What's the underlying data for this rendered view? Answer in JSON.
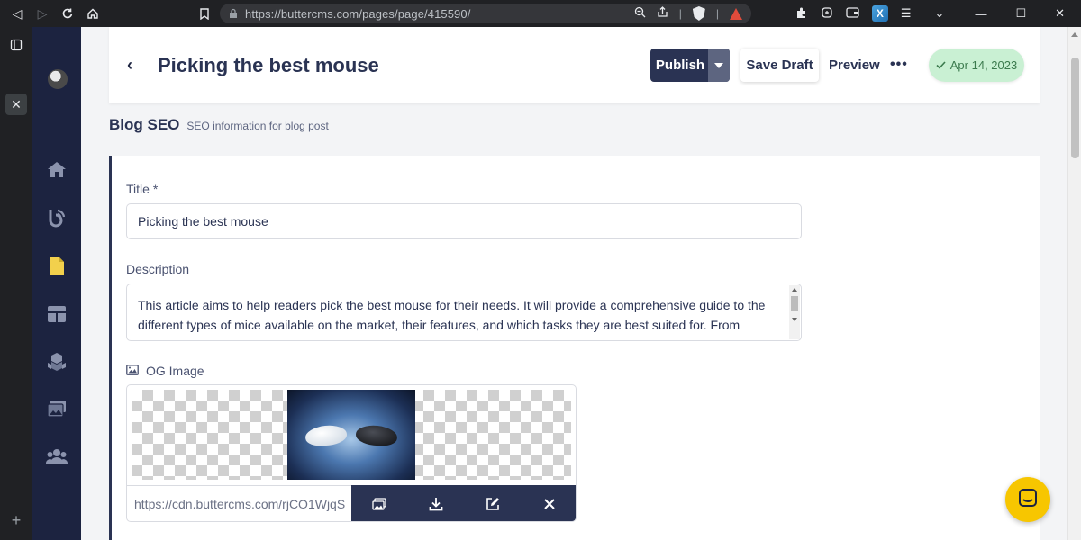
{
  "browser": {
    "url": "https://buttercms.com/pages/page/415590/"
  },
  "header": {
    "title": "Picking the best mouse",
    "publish_label": "Publish",
    "save_draft_label": "Save Draft",
    "preview_label": "Preview",
    "more_label": "•••",
    "date_label": "Apr 14, 2023"
  },
  "section": {
    "title": "Blog SEO",
    "subtitle": "SEO information for blog post"
  },
  "form": {
    "title_label": "Title *",
    "title_value": "Picking the best mouse",
    "description_label": "Description",
    "description_value": "This article aims to help readers pick the best mouse for their needs. It will provide a comprehensive guide to the different types of mice available on the market, their features, and which tasks they are best suited for. From gaming to productivity, there is a mouse out there for everyone, and this article will help readers make an informed",
    "og_label": "OG Image",
    "og_url": "https://cdn.buttercms.com/rjCO1WjqS"
  },
  "colors": {
    "nav_bg": "#1c2340",
    "primary": "#2a3353",
    "success_bg": "#c9f0d3",
    "chat_yellow": "#f7c600"
  }
}
